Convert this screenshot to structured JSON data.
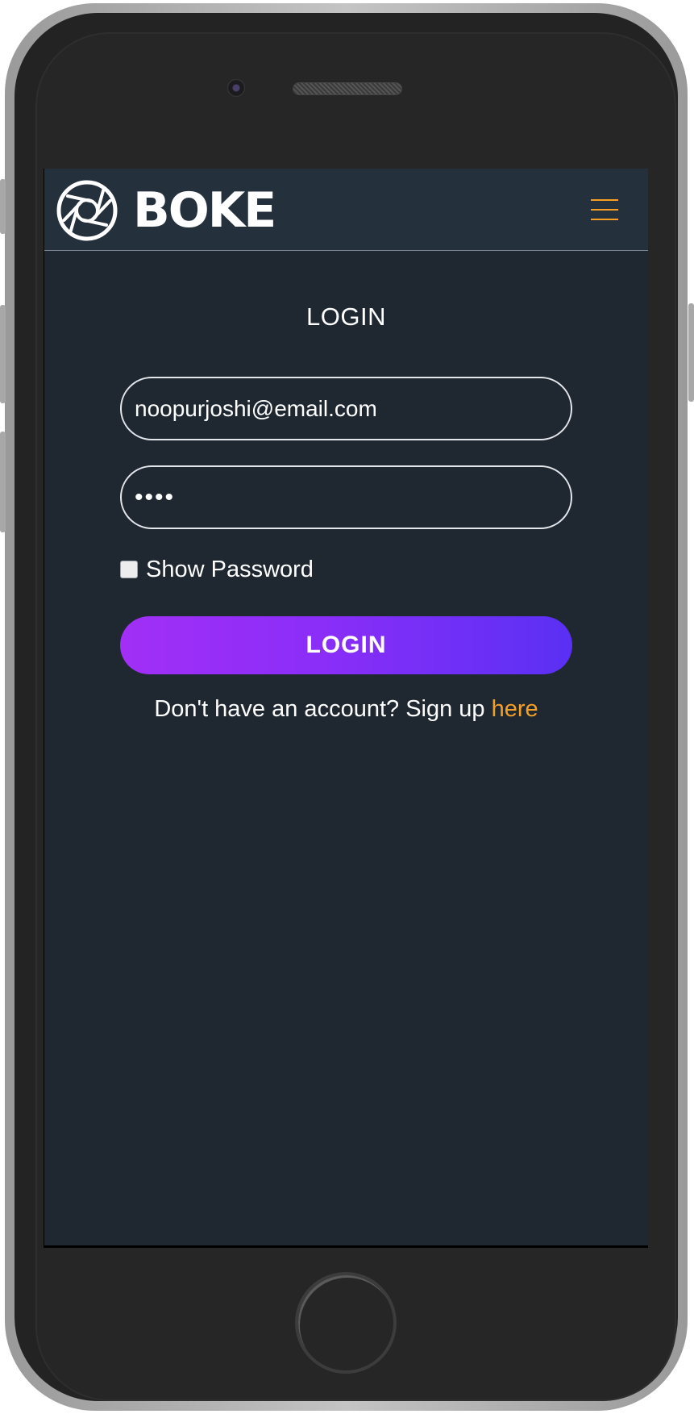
{
  "header": {
    "brand": "BOKE",
    "menu_icon": "hamburger-icon",
    "logo_icon": "camera-aperture-icon",
    "accent_color": "#f5a025"
  },
  "login": {
    "title": "LOGIN",
    "email_value": "noopurjoshi@email.com",
    "password_value": "••••",
    "show_password_label": "Show Password",
    "show_password_checked": false,
    "button_label": "LOGIN",
    "signup_prompt": "Don't have an account? Sign up ",
    "signup_link": "here"
  },
  "colors": {
    "screen_background": "#1f2730",
    "navbar_background": "#25303d",
    "button_gradient_start": "#a22ff6",
    "button_gradient_end": "#5a30f4"
  }
}
